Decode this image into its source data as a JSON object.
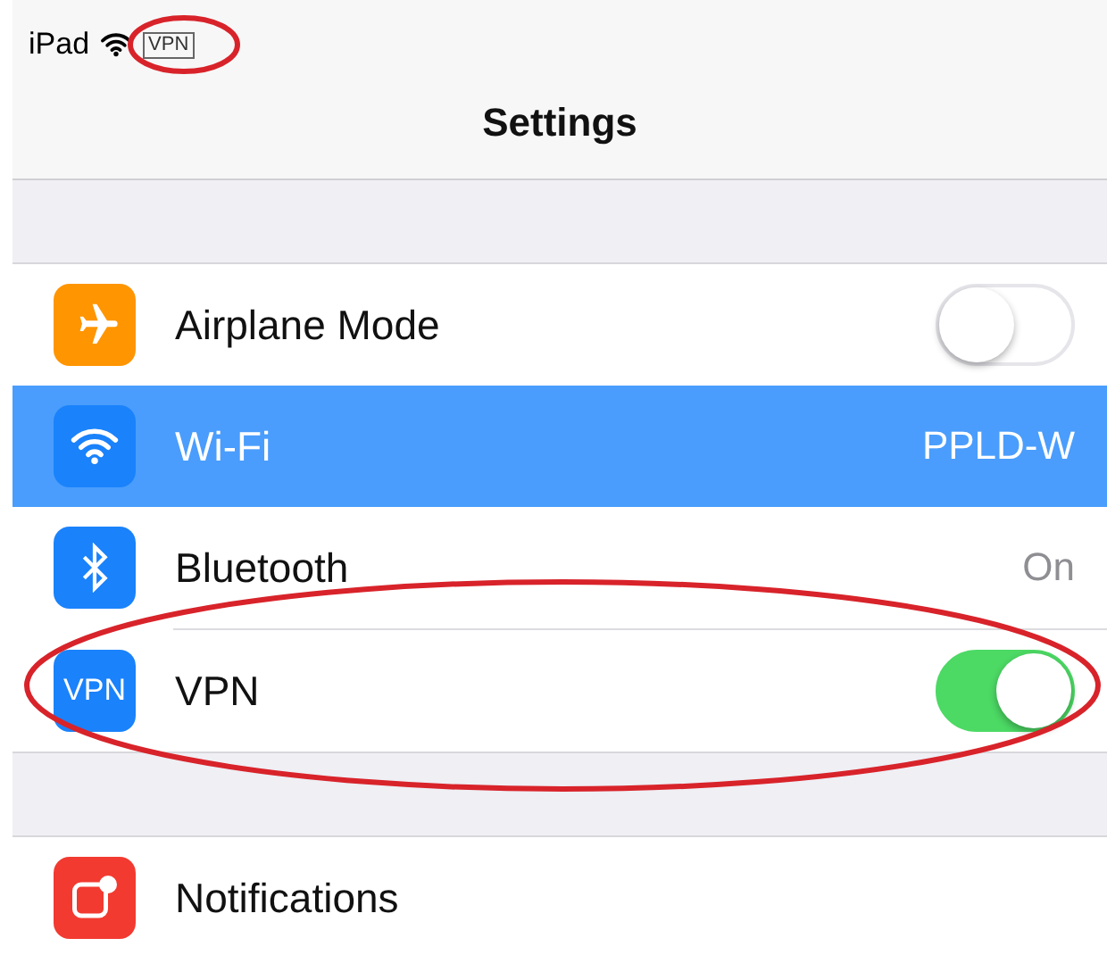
{
  "status_bar": {
    "device": "iPad",
    "vpn_badge": "VPN"
  },
  "nav": {
    "title": "Settings"
  },
  "groups": [
    {
      "rows": [
        {
          "kind": "toggle",
          "label": "Airplane Mode",
          "color": "#ff9500",
          "on": false,
          "selected": false
        },
        {
          "kind": "value",
          "label": "Wi-Fi",
          "color": "#1a82fb",
          "value": "PPLD-W",
          "selected": true
        },
        {
          "kind": "value",
          "label": "Bluetooth",
          "color": "#1a82fb",
          "value": "On",
          "selected": false
        },
        {
          "kind": "toggle",
          "label": "VPN",
          "icon_label": "VPN",
          "color": "#1a82fb",
          "on": true,
          "selected": false
        }
      ]
    },
    {
      "rows": [
        {
          "kind": "plain",
          "label": "Notifications",
          "color": "#f23a30",
          "selected": false
        }
      ]
    }
  ],
  "annotations": [
    {
      "kind": "ellipse"
    },
    {
      "kind": "ellipse"
    }
  ]
}
